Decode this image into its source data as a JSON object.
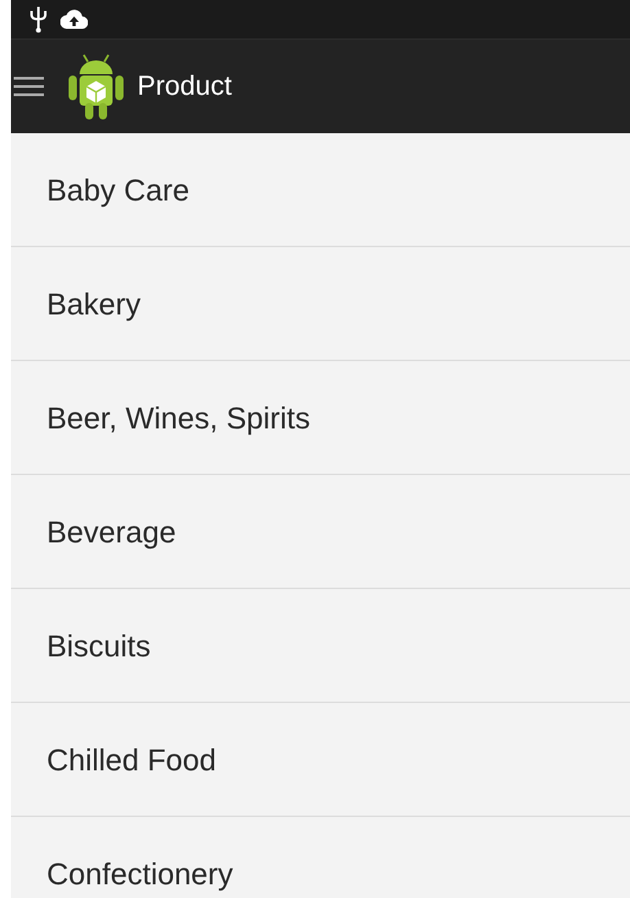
{
  "action_bar": {
    "title": "Product"
  },
  "categories": [
    {
      "label": "Baby Care"
    },
    {
      "label": "Bakery"
    },
    {
      "label": "Beer, Wines, Spirits"
    },
    {
      "label": "Beverage"
    },
    {
      "label": "Biscuits"
    },
    {
      "label": "Chilled Food"
    },
    {
      "label": "Confectionery"
    }
  ]
}
